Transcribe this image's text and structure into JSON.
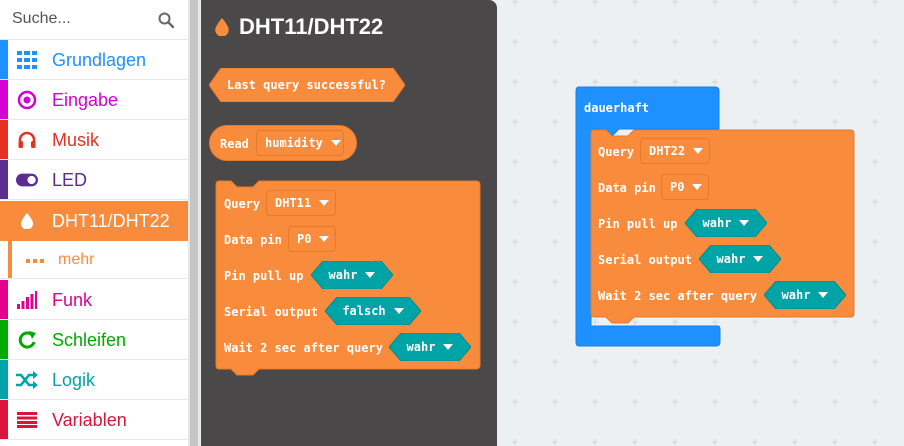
{
  "search": {
    "placeholder": "Suche...",
    "icon": "search-icon"
  },
  "categories": [
    {
      "label": "Grundlagen",
      "color": "#1e90ff",
      "icon": "grid-icon"
    },
    {
      "label": "Eingabe",
      "color": "#d400d4",
      "icon": "target-icon"
    },
    {
      "label": "Musik",
      "color": "#e63022",
      "icon": "headphones-icon"
    },
    {
      "label": "LED",
      "color": "#5c2d91",
      "icon": "toggle-icon"
    },
    {
      "label": "DHT11/DHT22",
      "color": "#f88c3c",
      "icon": "drop-icon",
      "active": true
    },
    {
      "label": "mehr",
      "color": "#f88c3c",
      "icon": "more-dots-icon",
      "sub": true
    },
    {
      "label": "Funk",
      "color": "#e3008c",
      "icon": "signal-icon"
    },
    {
      "label": "Schleifen",
      "color": "#00aa00",
      "icon": "refresh-icon"
    },
    {
      "label": "Logik",
      "color": "#00a4a6",
      "icon": "shuffle-icon"
    },
    {
      "label": "Variablen",
      "color": "#dc143c",
      "icon": "list-icon"
    }
  ],
  "flyout": {
    "title": "DHT11/DHT22",
    "block_query": "Last query successful?",
    "block_read": {
      "label": "Read",
      "value": "humidity"
    },
    "block_setup": {
      "query_label": "Query",
      "query_value": "DHT11",
      "pin_label": "Data pin",
      "pin_value": "P0",
      "pull_label": "Pin pull up",
      "pull_value": "wahr",
      "serial_label": "Serial output",
      "serial_value": "falsch",
      "wait_label": "Wait 2 sec after query",
      "wait_value": "wahr"
    }
  },
  "workspace": {
    "forever_label": "dauerhaft",
    "setup": {
      "query_label": "Query",
      "query_value": "DHT22",
      "pin_label": "Data pin",
      "pin_value": "P0",
      "pull_label": "Pin pull up",
      "pull_value": "wahr",
      "serial_label": "Serial output",
      "serial_value": "wahr",
      "wait_label": "Wait 2 sec after query",
      "wait_value": "wahr"
    }
  },
  "colors": {
    "dht": "#f88c3c",
    "dht_dark": "#e57a2b",
    "logic": "#00a4a6",
    "basic": "#1e90ff",
    "flyout_bg": "#4a4848"
  }
}
